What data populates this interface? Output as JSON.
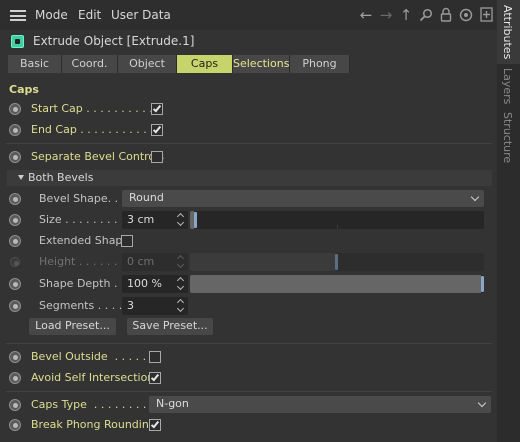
{
  "menu": {
    "items": [
      "Mode",
      "Edit",
      "User Data"
    ],
    "toolbar_icons": [
      "arrow-left-icon",
      "arrow-right-icon",
      "arrow-up-icon",
      "search-icon",
      "lock-icon",
      "target-icon",
      "new-panel-icon"
    ]
  },
  "object": {
    "title": "Extrude Object [Extrude.1]",
    "icon": "extrude-object-icon",
    "icon_color": "#3fcfa1"
  },
  "tabs": [
    {
      "label": "Basic",
      "active": false
    },
    {
      "label": "Coord.",
      "active": false
    },
    {
      "label": "Object",
      "active": false
    },
    {
      "label": "Caps",
      "active": true
    },
    {
      "label": "Selections",
      "active": false
    },
    {
      "label": "Phong",
      "active": false
    }
  ],
  "section": {
    "title": "Caps"
  },
  "caps": {
    "start_cap": {
      "label": "Start Cap . . . . . . . . . .",
      "checked": true
    },
    "end_cap": {
      "label": "End Cap . . . . . . . . . . .",
      "checked": true
    }
  },
  "separate_bevel": {
    "label": "Separate Bevel Controls",
    "checked": false
  },
  "group": {
    "label": "Both Bevels",
    "expanded": true
  },
  "bevel": {
    "shape": {
      "label": "Bevel Shape. . .",
      "value": "Round"
    },
    "size": {
      "label": "Size . . . . . . . . .",
      "value": "3 cm",
      "slider_fraction": 0.02
    },
    "extended_shape": {
      "label": "Extended Shape",
      "checked": false
    },
    "height": {
      "label": "Height . . . . . . .",
      "value": "0 cm",
      "slider_fraction": 0.5,
      "enabled": false
    },
    "shape_depth": {
      "label": "Shape Depth . .",
      "value": "100 %",
      "slider_fraction": 1.0
    },
    "segments": {
      "label": "Segments . . . .",
      "value": "3"
    },
    "load_preset": "Load Preset...",
    "save_preset": "Save Preset..."
  },
  "bevel_outside": {
    "label": "Bevel Outside  . . . . . .",
    "checked": false
  },
  "avoid_self_intersections": {
    "label": "Avoid Self Intersections",
    "checked": true
  },
  "caps_type": {
    "label": "Caps Type  . . . . . . . . . .",
    "value": "N-gon"
  },
  "break_phong": {
    "label": "Break Phong Rounding",
    "checked": true
  },
  "sidebar": {
    "tabs": [
      {
        "label": "Attributes",
        "active": true
      },
      {
        "label": "Layers",
        "active": false
      },
      {
        "label": "Structure",
        "active": false
      }
    ]
  },
  "colors": {
    "accent_tab": "#c6d46b",
    "label_yellow": "#dede92",
    "background": "#333333",
    "slider_thumb": "#8aa6c8"
  }
}
